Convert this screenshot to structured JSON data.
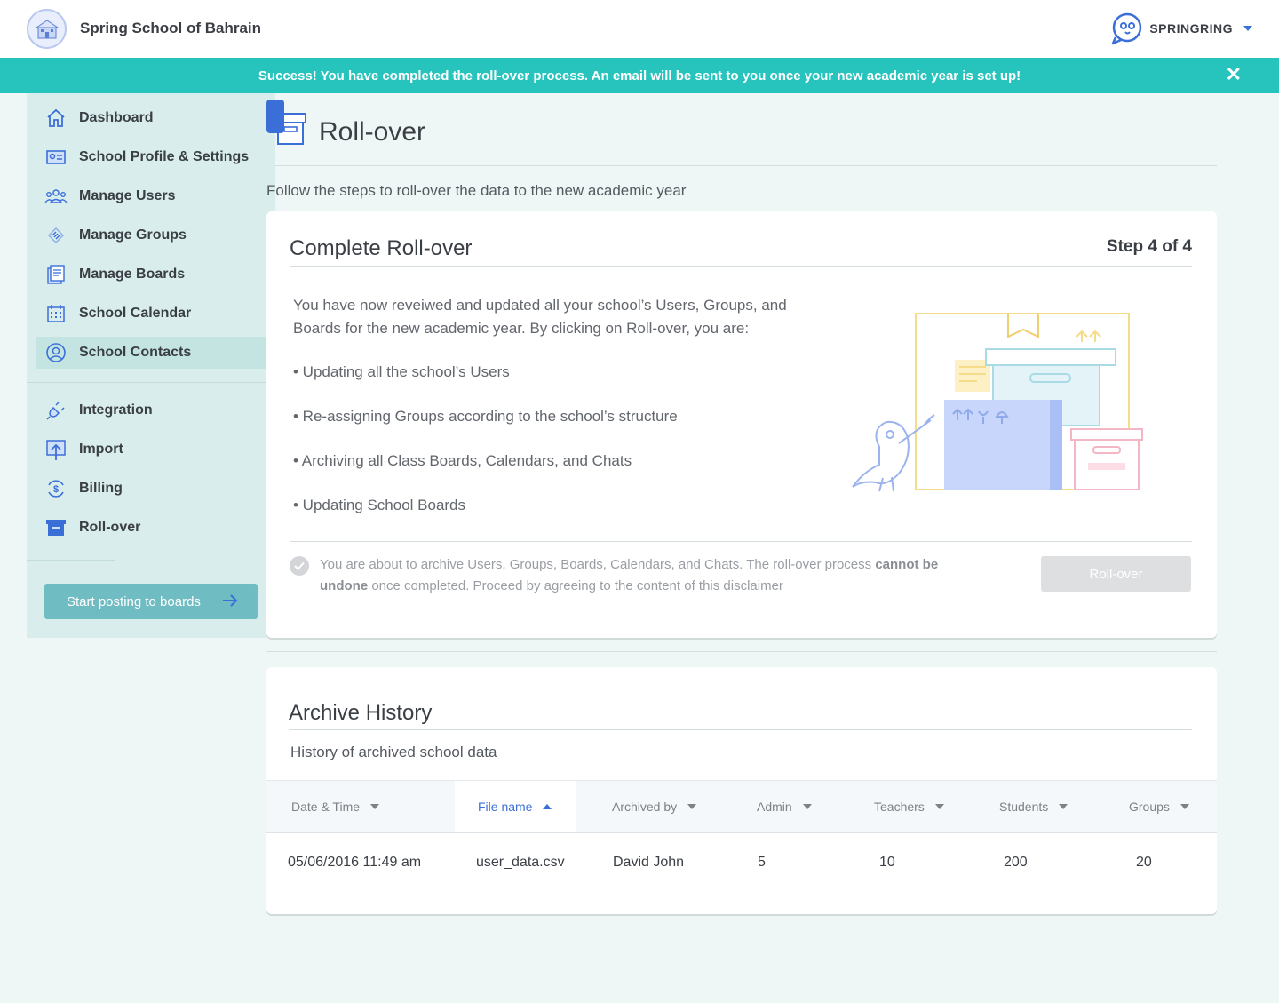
{
  "header": {
    "school_name": "Spring School of Bahrain",
    "brand_name": "SPRINGRING",
    "brand_icon": "owl-chat-icon",
    "school_logo": "school-building-logo"
  },
  "banner": {
    "message": "Success! You have completed the roll-over process. An email will be sent to you once your new academic year is set up!",
    "close_symbol": "✕",
    "color": "#26c4bd"
  },
  "sidebar": {
    "items": [
      {
        "label": "Dashboard",
        "icon": "home-icon"
      },
      {
        "label": "School Profile & Settings",
        "icon": "profile-card-icon"
      },
      {
        "label": "Manage Users",
        "icon": "users-icon"
      },
      {
        "label": "Manage Groups",
        "icon": "groups-icon"
      },
      {
        "label": "Manage Boards",
        "icon": "boards-icon"
      },
      {
        "label": "School Calendar",
        "icon": "calendar-icon"
      },
      {
        "label": "School Contacts",
        "icon": "contacts-icon",
        "active": true
      },
      {
        "label": "Integration",
        "icon": "plug-icon"
      },
      {
        "label": "Import",
        "icon": "import-icon"
      },
      {
        "label": "Billing",
        "icon": "billing-icon"
      },
      {
        "label": "Roll-over",
        "icon": "rollover-box-icon"
      }
    ],
    "cta_label": "Start posting to boards"
  },
  "main": {
    "title": "Roll-over",
    "subtitle": "Follow the steps to roll-over the data to the new academic year",
    "complete": {
      "title": "Complete Roll-over",
      "step": "Step 4 of 4",
      "intro": "You have now reveiwed and updated all your school’s Users, Groups, and Boards for the new academic year. By clicking on Roll-over, you are:",
      "bullets": [
        "• Updating all the school’s Users",
        "• Re-assigning Groups according to the school’s structure",
        "• Archiving all Class Boards, Calendars, and Chats",
        "• Updating School Boards"
      ],
      "disclaimer_pre": "You are about to archive Users, Groups, Boards, Calendars, and Chats. The roll-over process ",
      "disclaimer_bold": "cannot be undone",
      "disclaimer_post": " once completed. Proceed by agreeing to the content of this disclaimer",
      "button_label": "Roll-over"
    },
    "history": {
      "title": "Archive History",
      "subtitle": "History of archived school data",
      "columns": [
        "Date & Time",
        "File name",
        "Archived by",
        "Admin",
        "Teachers",
        "Students",
        "Groups"
      ],
      "sorted_column": "File name",
      "rows": [
        [
          "05/06/2016 11:49 am",
          "user_data.csv",
          "David John",
          "5",
          "10",
          "200",
          "20"
        ]
      ]
    }
  }
}
